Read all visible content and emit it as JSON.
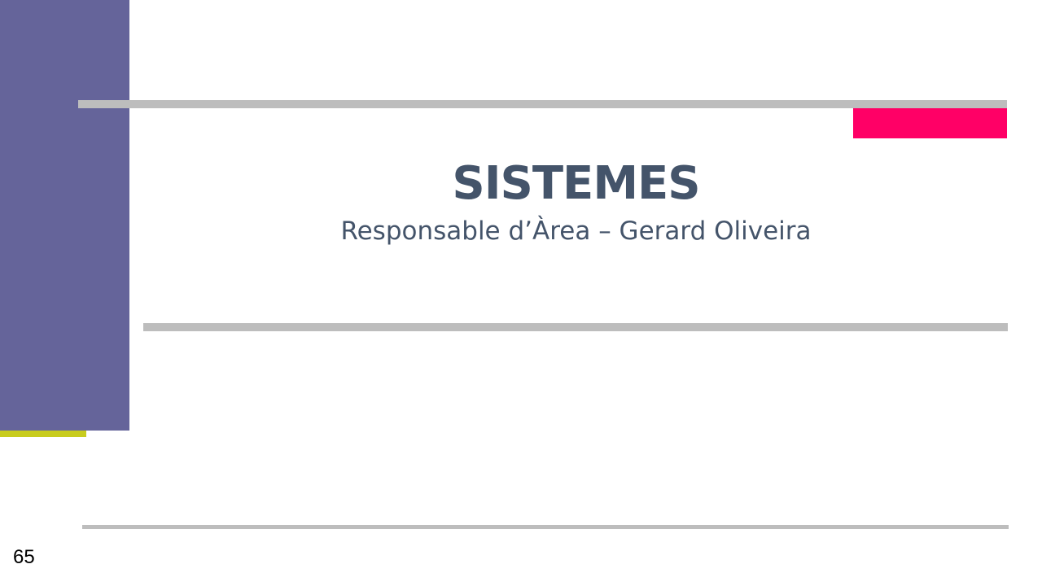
{
  "slide": {
    "title": "SISTEMES",
    "subtitle": "Responsable d’Àrea – Gerard Oliveira",
    "page_number": "65"
  },
  "colors": {
    "side_bar": "#65649a",
    "accent_pink": "#ff0066",
    "accent_yellow": "#c8cc1e",
    "rule_gray": "#bdbdbd",
    "text": "#44546a"
  }
}
